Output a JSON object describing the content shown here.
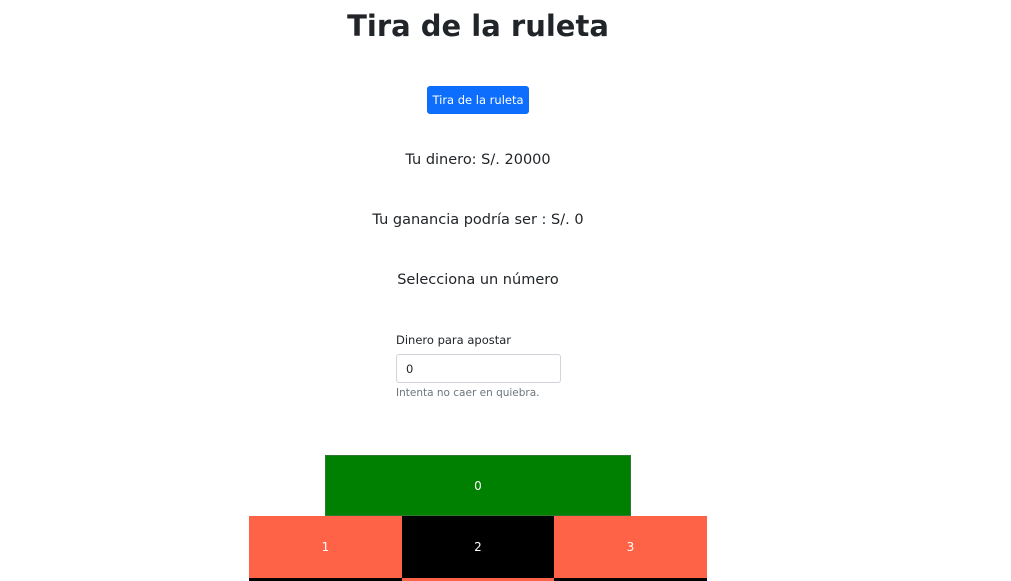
{
  "header": {
    "title": "Tira de la ruleta"
  },
  "spin_button": {
    "label": "Tira de la ruleta"
  },
  "status": {
    "money": "Tu dinero: S/. 20000",
    "gain": "Tu ganancia podría ser : S/. 0",
    "select_prompt": "Selecciona un número"
  },
  "bet_form": {
    "label": "Dinero para apostar",
    "value": "0",
    "help": "Intenta no caer en quiebra."
  },
  "board": {
    "zero": {
      "label": "0",
      "color": "#008000"
    },
    "row1": [
      {
        "label": "1",
        "color": "#ff6347"
      },
      {
        "label": "2",
        "color": "#000000"
      },
      {
        "label": "3",
        "color": "#ff6347"
      }
    ],
    "next_row_colors": [
      "#000000",
      "#ff6347",
      "#000000"
    ]
  },
  "colors": {
    "primary": "#0d6efd",
    "text": "#212529",
    "muted": "#6c757d"
  }
}
